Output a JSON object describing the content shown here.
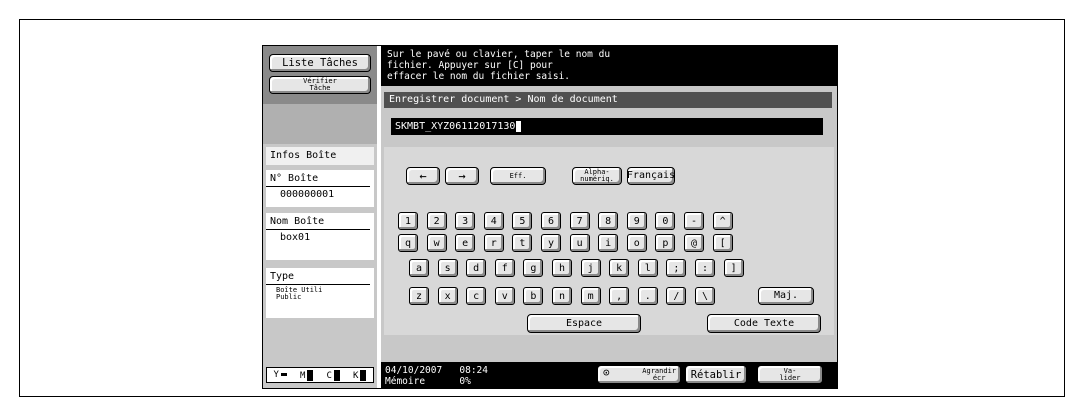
{
  "left_panel": {
    "job_list": "Liste Tâches",
    "check_job": "Vérifier\nTâche",
    "info_header": "Infos Boîte",
    "box_no_label": "N° Boîte",
    "box_no_value": "000000001",
    "box_name_label": "Nom Boîte",
    "box_name_value": "box01",
    "type_label": "Type",
    "type_value": "Boîte Utili\nPublic",
    "toner": [
      "Y",
      "M",
      "C",
      "K"
    ]
  },
  "message": "Sur le pavé ou clavier, taper le nom du\nfichier. Appuyer sur [C] pour\neffacer le nom du fichier saisi.",
  "breadcrumb": "Enregistrer document > Nom de document",
  "input_value": "SKMBT_XYZ06112017130",
  "controls": {
    "left_arrow": "←",
    "right_arrow": "→",
    "erase": "Eff.",
    "alphanum": "Alpha-\nnumériq.",
    "language": "Français"
  },
  "keys": {
    "row1": [
      "1",
      "2",
      "3",
      "4",
      "5",
      "6",
      "7",
      "8",
      "9",
      "0",
      "-",
      "^"
    ],
    "row2": [
      "q",
      "w",
      "e",
      "r",
      "t",
      "y",
      "u",
      "i",
      "o",
      "p",
      "@",
      "["
    ],
    "row3": [
      "a",
      "s",
      "d",
      "f",
      "g",
      "h",
      "j",
      "k",
      "l",
      ";",
      ":",
      "]"
    ],
    "row4": [
      "z",
      "x",
      "c",
      "v",
      "b",
      "n",
      "m",
      ",",
      ".",
      "/",
      "\\"
    ],
    "shift": "Maj.",
    "space": "Espace",
    "code": "Code Texte"
  },
  "status": {
    "date": "04/10/2007",
    "time": "08:24",
    "memory_label": "Mémoire",
    "memory_value": "0%"
  },
  "bottom": {
    "enlarge": "Agrandir\nécr",
    "reset": "Rétablir",
    "validate": "Va-\nlider"
  }
}
